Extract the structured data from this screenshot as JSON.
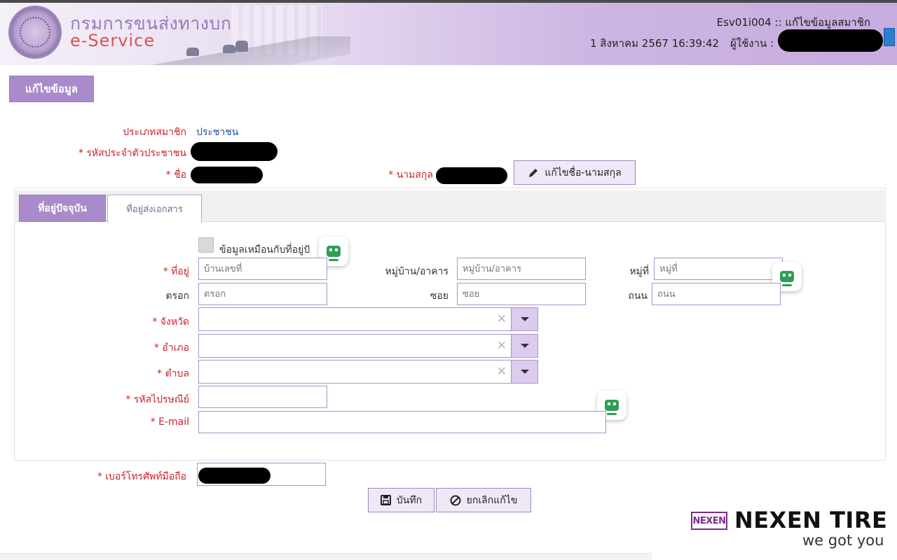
{
  "header": {
    "department": "กรมการขนส่งทางบก",
    "service": "e-Service",
    "screen_code": "Esv01i004 :: แก้ไขข้อมูลสมาชิก",
    "datetime": "1 สิงหาคม 2567 16:39:42",
    "user_label": "ผู้ใช้งาน :"
  },
  "page": {
    "tab_title": "แก้ไขข้อมูล"
  },
  "member": {
    "type_label": "ประเภทสมาชิก",
    "type_value": "ประชาชน",
    "citizen_id_label": "* รหัสประจำตัวประชาชน",
    "first_name_label": "* ชื่อ",
    "last_name_label": "* นามสกุล",
    "edit_name_button": "แก้ไขชื่อ-นามสกุล"
  },
  "address": {
    "tabs": [
      "ที่อยู่ปัจจุบัน",
      "ที่อยู่ส่งเอกสาร"
    ],
    "same_as_label": "ข้อมูลเหมือนกับที่อยู่ปั",
    "fields": {
      "house_no": {
        "label": "* ที่อยู่",
        "placeholder": "บ้านเลขที่"
      },
      "village": {
        "label": "หมู่บ้าน/อาคาร",
        "placeholder": "หมู่บ้าน/อาคาร"
      },
      "moo": {
        "label": "หมู่ที่",
        "placeholder": "หมู่ที่"
      },
      "alley": {
        "label": "ตรอก",
        "placeholder": "ตรอก"
      },
      "soi": {
        "label": "ซอย",
        "placeholder": "ซอย"
      },
      "road": {
        "label": "ถนน",
        "placeholder": "ถนน"
      },
      "province": {
        "label": "* จังหวัด"
      },
      "district": {
        "label": "* อำเภอ"
      },
      "subdistrict": {
        "label": "* ตำบล"
      },
      "postcode": {
        "label": "* รหัสไปรษณีย์"
      },
      "email": {
        "label": "* E-mail"
      }
    }
  },
  "phone_label": "* เบอร์โทรศัพท์มือถือ",
  "buttons": {
    "save": "บันทึก",
    "cancel": "ยกเลิกแก้ไข"
  },
  "watermark": {
    "brand_mark": "NEXEN",
    "brand_name": "NEXEN TIRE",
    "tagline": "we got you"
  },
  "colors": {
    "accent": "#a98bcb",
    "required": "#cc2229",
    "link_blue": "#1f4f9e"
  }
}
